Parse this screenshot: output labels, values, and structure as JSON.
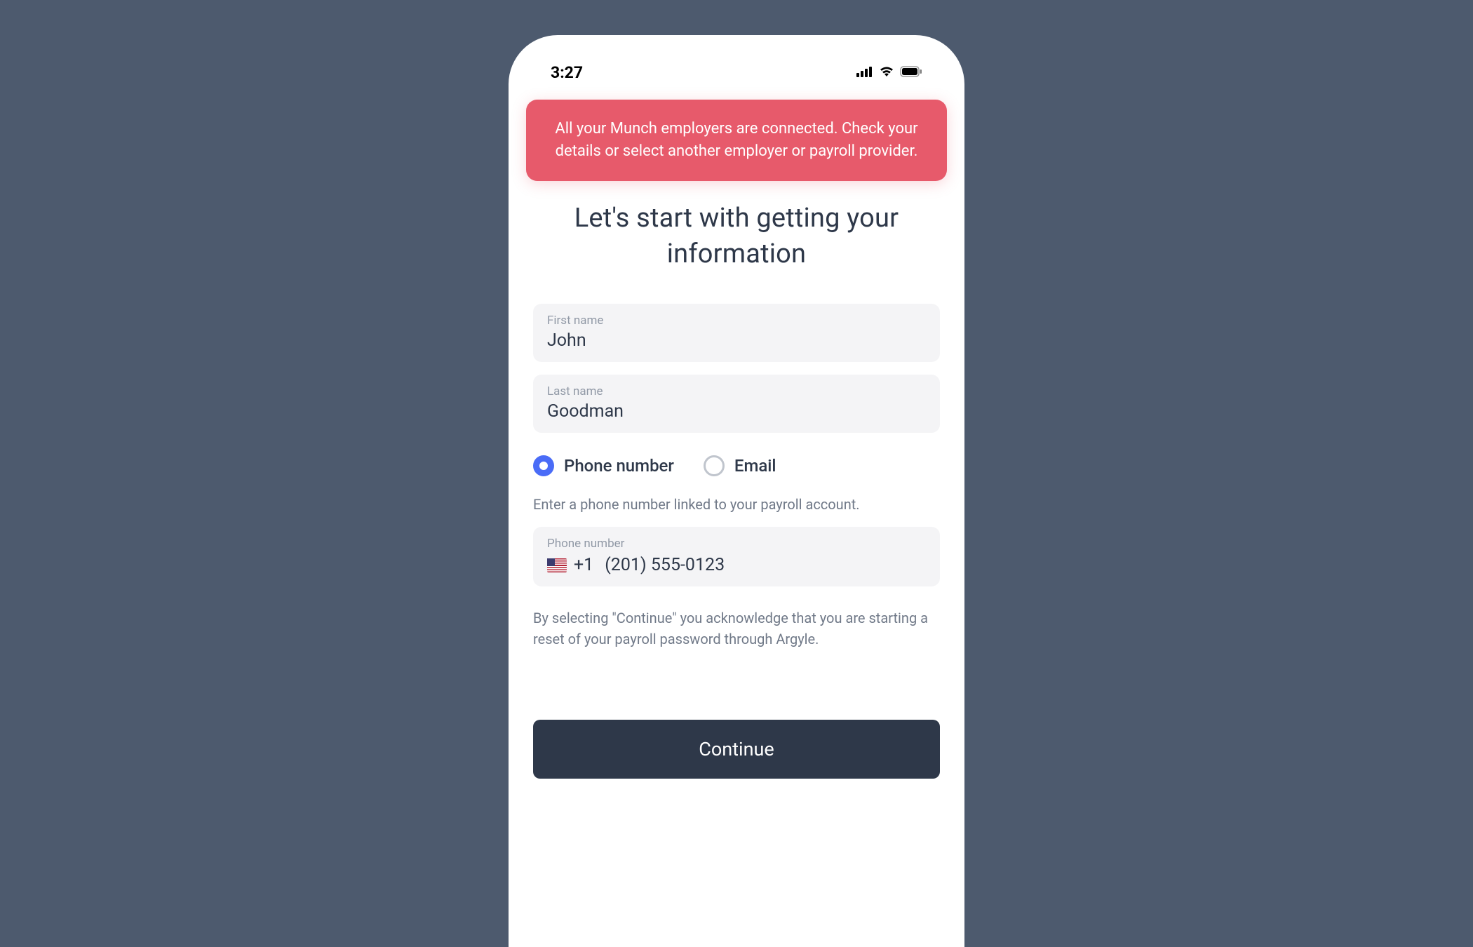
{
  "status_bar": {
    "time": "3:27"
  },
  "notification": {
    "message": "All your Munch employers are connected. Check your details or select another employer or payroll provider."
  },
  "heading": "Let's start with getting your information",
  "form": {
    "first_name": {
      "label": "First name",
      "value": "John"
    },
    "last_name": {
      "label": "Last name",
      "value": "Goodman"
    },
    "contact_method": {
      "options": [
        {
          "label": "Phone number",
          "selected": true
        },
        {
          "label": "Email",
          "selected": false
        }
      ]
    },
    "phone": {
      "helper": "Enter a phone number linked to your payroll account.",
      "label": "Phone number",
      "country_code": "+1",
      "value": "(201) 555-0123"
    },
    "disclaimer": "By selecting \"Continue\" you acknowledge that you are starting a reset of your payroll password through Argyle.",
    "continue_label": "Continue"
  }
}
